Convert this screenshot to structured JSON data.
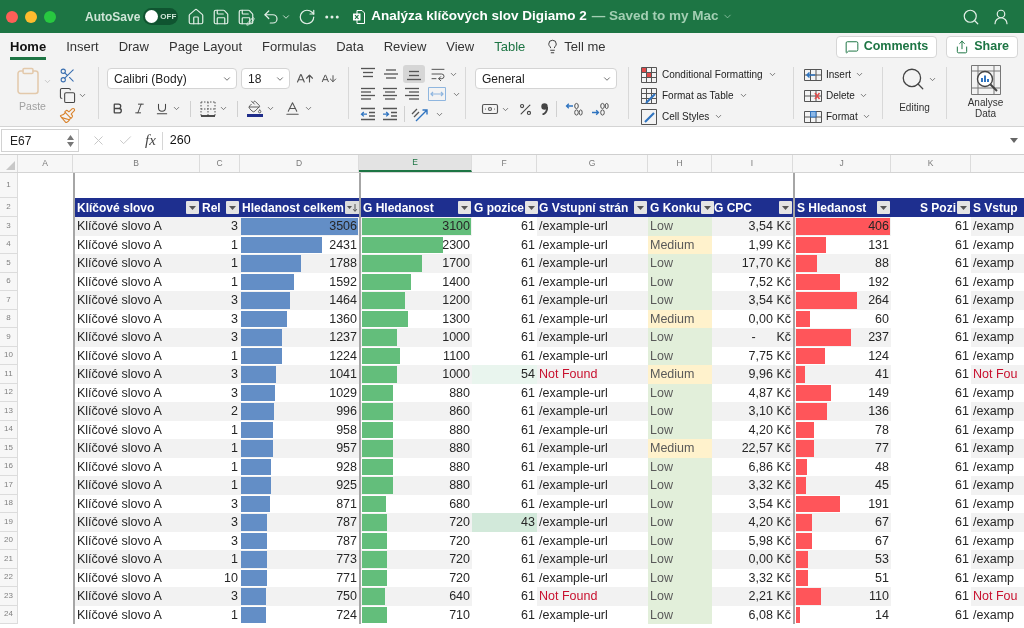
{
  "window": {
    "title": "Analýza klíčových slov Digiamo 2",
    "save_status": "— Saved to my Mac",
    "autosave": {
      "label": "AutoSave",
      "on": false,
      "switch_text": "OFF"
    }
  },
  "ribbon_tabs": [
    {
      "label": "Home",
      "selected": true,
      "kind": "standard"
    },
    {
      "label": "Insert",
      "selected": false,
      "kind": "standard"
    },
    {
      "label": "Draw",
      "selected": false,
      "kind": "standard"
    },
    {
      "label": "Page Layout",
      "selected": false,
      "kind": "standard"
    },
    {
      "label": "Formulas",
      "selected": false,
      "kind": "standard"
    },
    {
      "label": "Data",
      "selected": false,
      "kind": "standard"
    },
    {
      "label": "Review",
      "selected": false,
      "kind": "standard"
    },
    {
      "label": "View",
      "selected": false,
      "kind": "standard"
    },
    {
      "label": "Table",
      "selected": false,
      "kind": "contextual"
    }
  ],
  "tell_me": "Tell me",
  "header_buttons": [
    {
      "label": "Comments",
      "kind": "comments"
    },
    {
      "label": "Share",
      "kind": "share"
    }
  ],
  "toolbar": {
    "paste": {
      "label": "Paste",
      "disabled": true
    },
    "font_name": "Calibri (Body)",
    "font_size": "18",
    "vertical_align": [
      {
        "kind": "top",
        "selected": false
      },
      {
        "kind": "middle",
        "selected": false
      },
      {
        "kind": "bottom",
        "selected": true
      }
    ],
    "number_format": "General",
    "styles": [
      {
        "label": "Conditional Formatting",
        "kind": "conditional"
      },
      {
        "label": "Format as Table",
        "kind": "table"
      },
      {
        "label": "Cell Styles",
        "kind": "cell_styles"
      }
    ],
    "cells": [
      {
        "label": "Insert",
        "kind": "insert"
      },
      {
        "label": "Delete",
        "kind": "delete"
      },
      {
        "label": "Format",
        "kind": "format"
      }
    ],
    "editing": "Editing",
    "analyse": "Analyse Data"
  },
  "formula_bar": {
    "name_box": "E67",
    "function_label": "fx",
    "value": "260"
  },
  "column_headers": [
    {
      "label": "A",
      "selected": false
    },
    {
      "label": "B",
      "selected": false
    },
    {
      "label": "C",
      "selected": false
    },
    {
      "label": "D",
      "selected": false
    },
    {
      "label": "E",
      "selected": true
    },
    {
      "label": "F",
      "selected": false
    },
    {
      "label": "G",
      "selected": false
    },
    {
      "label": "H",
      "selected": false
    },
    {
      "label": "I",
      "selected": false
    },
    {
      "label": "J",
      "selected": false
    },
    {
      "label": "K",
      "selected": false
    }
  ],
  "row_numbers": [
    "1",
    "2",
    "3",
    "4",
    "5",
    "6",
    "7",
    "8",
    "9",
    "10",
    "11",
    "12",
    "13",
    "14",
    "15",
    "16",
    "17",
    "18",
    "19",
    "20",
    "21",
    "22",
    "23",
    "24"
  ],
  "table": {
    "columns": [
      {
        "label": "Klíčové slovo",
        "kind": "text",
        "filter": true,
        "sorted": false
      },
      {
        "label": "Rel",
        "kind": "number",
        "filter": true,
        "sorted": false
      },
      {
        "label": "Hledanost celkem",
        "kind": "data_bar",
        "color": "#638ec6",
        "filter": true,
        "sorted": true
      },
      {
        "label": "G Hledanost",
        "kind": "data_bar",
        "color": "#63be7b",
        "filter": true,
        "sorted": false
      },
      {
        "label": "G pozice",
        "kind": "scale",
        "filter": true,
        "sorted": false
      },
      {
        "label": "G Vstupní strán",
        "kind": "link",
        "filter": true,
        "sorted": false
      },
      {
        "label": "G Konku",
        "kind": "tag",
        "filter": true,
        "sorted": false
      },
      {
        "label": "G CPC",
        "kind": "number",
        "filter": true,
        "sorted": false
      },
      {
        "label": "S Hledanost",
        "kind": "data_bar",
        "color": "#ff555a",
        "filter": true,
        "sorted": false
      },
      {
        "label": "S Pozi",
        "kind": "scale",
        "filter": true,
        "sorted": false
      },
      {
        "label": "S Vstup",
        "kind": "link"
      }
    ],
    "rows": [
      {
        "cells": [
          "Klíčové slovo A",
          "3",
          {
            "text": "3506",
            "level": 1
          },
          {
            "text": "3100",
            "level": 1
          },
          {
            "text": "61",
            "color": "#ffffff"
          },
          {
            "text": "/example-url",
            "kind": "url"
          },
          {
            "text": "Low",
            "color": "#e2efda"
          },
          "3,54 Kč",
          {
            "text": "406",
            "level": 1
          },
          {
            "text": "61",
            "color": "#ffffff"
          },
          {
            "text": "/examp",
            "kind": "url"
          }
        ]
      },
      {
        "cells": [
          "Klíčové slovo A",
          "1",
          {
            "text": "2431",
            "level": 0.69
          },
          {
            "text": "2300",
            "level": 0.74
          },
          {
            "text": "61",
            "color": "#ffffff"
          },
          {
            "text": "/example-url",
            "kind": "url"
          },
          {
            "text": "Medium",
            "color": "#fff2cc"
          },
          "1,99 Kč",
          {
            "text": "131",
            "level": 0.32
          },
          {
            "text": "61",
            "color": "#ffffff"
          },
          {
            "text": "/examp",
            "kind": "url"
          }
        ]
      },
      {
        "cells": [
          "Klíčové slovo A",
          "1",
          {
            "text": "1788",
            "level": 0.51
          },
          {
            "text": "1700",
            "level": 0.55
          },
          {
            "text": "61",
            "color": "#ffffff"
          },
          {
            "text": "/example-url",
            "kind": "url"
          },
          {
            "text": "Low",
            "color": "#e2efda"
          },
          "17,70 Kč",
          {
            "text": "88",
            "level": 0.22
          },
          {
            "text": "61",
            "color": "#ffffff"
          },
          {
            "text": "/examp",
            "kind": "url"
          }
        ]
      },
      {
        "cells": [
          "Klíčové slovo A",
          "1",
          {
            "text": "1592",
            "level": 0.45
          },
          {
            "text": "1400",
            "level": 0.45
          },
          {
            "text": "61",
            "color": "#ffffff"
          },
          {
            "text": "/example-url",
            "kind": "url"
          },
          {
            "text": "Low",
            "color": "#e2efda"
          },
          "7,52 Kč",
          {
            "text": "192",
            "level": 0.47
          },
          {
            "text": "61",
            "color": "#ffffff"
          },
          {
            "text": "/examp",
            "kind": "url"
          }
        ]
      },
      {
        "cells": [
          "Klíčové slovo A",
          "3",
          {
            "text": "1464",
            "level": 0.42
          },
          {
            "text": "1200",
            "level": 0.39
          },
          {
            "text": "61",
            "color": "#ffffff"
          },
          {
            "text": "/example-url",
            "kind": "url"
          },
          {
            "text": "Low",
            "color": "#e2efda"
          },
          "3,54 Kč",
          {
            "text": "264",
            "level": 0.65
          },
          {
            "text": "61",
            "color": "#ffffff"
          },
          {
            "text": "/examp",
            "kind": "url"
          }
        ]
      },
      {
        "cells": [
          "Klíčové slovo A",
          "3",
          {
            "text": "1360",
            "level": 0.39
          },
          {
            "text": "1300",
            "level": 0.42
          },
          {
            "text": "61",
            "color": "#ffffff"
          },
          {
            "text": "/example-url",
            "kind": "url"
          },
          {
            "text": "Medium",
            "color": "#fff2cc"
          },
          "0,00 Kč",
          {
            "text": "60",
            "level": 0.15
          },
          {
            "text": "61",
            "color": "#ffffff"
          },
          {
            "text": "/examp",
            "kind": "url"
          }
        ]
      },
      {
        "cells": [
          "Klíčové slovo A",
          "3",
          {
            "text": "1237",
            "level": 0.35
          },
          {
            "text": "1000",
            "level": 0.32
          },
          {
            "text": "61",
            "color": "#ffffff"
          },
          {
            "text": "/example-url",
            "kind": "url"
          },
          {
            "text": "Low",
            "color": "#e2efda"
          },
          "-      Kč",
          {
            "text": "237",
            "level": 0.58
          },
          {
            "text": "61",
            "color": "#ffffff"
          },
          {
            "text": "/examp",
            "kind": "url"
          }
        ]
      },
      {
        "cells": [
          "Klíčové slovo A",
          "1",
          {
            "text": "1224",
            "level": 0.35
          },
          {
            "text": "1100",
            "level": 0.35
          },
          {
            "text": "61",
            "color": "#ffffff"
          },
          {
            "text": "/example-url",
            "kind": "url"
          },
          {
            "text": "Low",
            "color": "#e2efda"
          },
          "7,75 Kč",
          {
            "text": "124",
            "level": 0.31
          },
          {
            "text": "61",
            "color": "#ffffff"
          },
          {
            "text": "/examp",
            "kind": "url"
          }
        ]
      },
      {
        "cells": [
          "Klíčové slovo A",
          "3",
          {
            "text": "1041",
            "level": 0.3
          },
          {
            "text": "1000",
            "level": 0.32
          },
          {
            "text": "54",
            "color": "#e9f5ee"
          },
          {
            "text": "Not Found",
            "kind": "not_found"
          },
          {
            "text": "Medium",
            "color": "#fff2cc"
          },
          "9,96 Kč",
          {
            "text": "41",
            "level": 0.1
          },
          {
            "text": "61",
            "color": "#ffffff"
          },
          {
            "text": "Not Fou",
            "kind": "not_found"
          }
        ]
      },
      {
        "cells": [
          "Klíčové slovo A",
          "3",
          {
            "text": "1029",
            "level": 0.29
          },
          {
            "text": "880",
            "level": 0.28
          },
          {
            "text": "61",
            "color": "#ffffff"
          },
          {
            "text": "/example-url",
            "kind": "url"
          },
          {
            "text": "Low",
            "color": "#e2efda"
          },
          "4,87 Kč",
          {
            "text": "149",
            "level": 0.37
          },
          {
            "text": "61",
            "color": "#ffffff"
          },
          {
            "text": "/examp",
            "kind": "url"
          }
        ]
      },
      {
        "cells": [
          "Klíčové slovo A",
          "2",
          {
            "text": "996",
            "level": 0.28
          },
          {
            "text": "860",
            "level": 0.28
          },
          {
            "text": "61",
            "color": "#ffffff"
          },
          {
            "text": "/example-url",
            "kind": "url"
          },
          {
            "text": "Low",
            "color": "#e2efda"
          },
          "3,10 Kč",
          {
            "text": "136",
            "level": 0.33
          },
          {
            "text": "61",
            "color": "#ffffff"
          },
          {
            "text": "/examp",
            "kind": "url"
          }
        ]
      },
      {
        "cells": [
          "Klíčové slovo A",
          "1",
          {
            "text": "958",
            "level": 0.27
          },
          {
            "text": "880",
            "level": 0.28
          },
          {
            "text": "61",
            "color": "#ffffff"
          },
          {
            "text": "/example-url",
            "kind": "url"
          },
          {
            "text": "Low",
            "color": "#e2efda"
          },
          "4,20 Kč",
          {
            "text": "78",
            "level": 0.19
          },
          {
            "text": "61",
            "color": "#ffffff"
          },
          {
            "text": "/examp",
            "kind": "url"
          }
        ]
      },
      {
        "cells": [
          "Klíčové slovo A",
          "1",
          {
            "text": "957",
            "level": 0.27
          },
          {
            "text": "880",
            "level": 0.28
          },
          {
            "text": "61",
            "color": "#ffffff"
          },
          {
            "text": "/example-url",
            "kind": "url"
          },
          {
            "text": "Medium",
            "color": "#fff2cc"
          },
          "22,57 Kč",
          {
            "text": "77",
            "level": 0.19
          },
          {
            "text": "61",
            "color": "#ffffff"
          },
          {
            "text": "/examp",
            "kind": "url"
          }
        ]
      },
      {
        "cells": [
          "Klíčové slovo A",
          "1",
          {
            "text": "928",
            "level": 0.26
          },
          {
            "text": "880",
            "level": 0.28
          },
          {
            "text": "61",
            "color": "#ffffff"
          },
          {
            "text": "/example-url",
            "kind": "url"
          },
          {
            "text": "Low",
            "color": "#e2efda"
          },
          "6,86 Kč",
          {
            "text": "48",
            "level": 0.12
          },
          {
            "text": "61",
            "color": "#ffffff"
          },
          {
            "text": "/examp",
            "kind": "url"
          }
        ]
      },
      {
        "cells": [
          "Klíčové slovo A",
          "1",
          {
            "text": "925",
            "level": 0.26
          },
          {
            "text": "880",
            "level": 0.28
          },
          {
            "text": "61",
            "color": "#ffffff"
          },
          {
            "text": "/example-url",
            "kind": "url"
          },
          {
            "text": "Low",
            "color": "#e2efda"
          },
          "3,32 Kč",
          {
            "text": "45",
            "level": 0.11
          },
          {
            "text": "61",
            "color": "#ffffff"
          },
          {
            "text": "/examp",
            "kind": "url"
          }
        ]
      },
      {
        "cells": [
          "Klíčové slovo A",
          "3",
          {
            "text": "871",
            "level": 0.25
          },
          {
            "text": "680",
            "level": 0.22
          },
          {
            "text": "61",
            "color": "#ffffff"
          },
          {
            "text": "/example-url",
            "kind": "url"
          },
          {
            "text": "Low",
            "color": "#e2efda"
          },
          "3,54 Kč",
          {
            "text": "191",
            "level": 0.47
          },
          {
            "text": "61",
            "color": "#ffffff"
          },
          {
            "text": "/examp",
            "kind": "url"
          }
        ]
      },
      {
        "cells": [
          "Klíčové slovo A",
          "3",
          {
            "text": "787",
            "level": 0.22
          },
          {
            "text": "720",
            "level": 0.23
          },
          {
            "text": "43",
            "color": "#d2e9da"
          },
          {
            "text": "/example-url",
            "kind": "url"
          },
          {
            "text": "Low",
            "color": "#e2efda"
          },
          "4,20 Kč",
          {
            "text": "67",
            "level": 0.17
          },
          {
            "text": "61",
            "color": "#ffffff"
          },
          {
            "text": "/examp",
            "kind": "url"
          }
        ]
      },
      {
        "cells": [
          "Klíčové slovo A",
          "3",
          {
            "text": "787",
            "level": 0.22
          },
          {
            "text": "720",
            "level": 0.23
          },
          {
            "text": "61",
            "color": "#ffffff"
          },
          {
            "text": "/example-url",
            "kind": "url"
          },
          {
            "text": "Low",
            "color": "#e2efda"
          },
          "5,98 Kč",
          {
            "text": "67",
            "level": 0.17
          },
          {
            "text": "61",
            "color": "#ffffff"
          },
          {
            "text": "/examp",
            "kind": "url"
          }
        ]
      },
      {
        "cells": [
          "Klíčové slovo A",
          "1",
          {
            "text": "773",
            "level": 0.22
          },
          {
            "text": "720",
            "level": 0.23
          },
          {
            "text": "61",
            "color": "#ffffff"
          },
          {
            "text": "/example-url",
            "kind": "url"
          },
          {
            "text": "Low",
            "color": "#e2efda"
          },
          "0,00 Kč",
          {
            "text": "53",
            "level": 0.13
          },
          {
            "text": "61",
            "color": "#ffffff"
          },
          {
            "text": "/examp",
            "kind": "url"
          }
        ]
      },
      {
        "cells": [
          "Klíčové slovo A",
          "10",
          {
            "text": "771",
            "level": 0.22
          },
          {
            "text": "720",
            "level": 0.23
          },
          {
            "text": "61",
            "color": "#ffffff"
          },
          {
            "text": "/example-url",
            "kind": "url"
          },
          {
            "text": "Low",
            "color": "#e2efda"
          },
          "3,32 Kč",
          {
            "text": "51",
            "level": 0.13
          },
          {
            "text": "61",
            "color": "#ffffff"
          },
          {
            "text": "/examp",
            "kind": "url"
          }
        ]
      },
      {
        "cells": [
          "Klíčové slovo A",
          "3",
          {
            "text": "750",
            "level": 0.21
          },
          {
            "text": "640",
            "level": 0.21
          },
          {
            "text": "61",
            "color": "#ffffff"
          },
          {
            "text": "Not Found",
            "kind": "not_found"
          },
          {
            "text": "Low",
            "color": "#e2efda"
          },
          "2,21 Kč",
          {
            "text": "110",
            "level": 0.27
          },
          {
            "text": "61",
            "color": "#ffffff"
          },
          {
            "text": "Not Fou",
            "kind": "not_found"
          }
        ]
      },
      {
        "cells": [
          "Klíčové slovo A",
          "1",
          {
            "text": "724",
            "level": 0.21
          },
          {
            "text": "710",
            "level": 0.23
          },
          {
            "text": "61",
            "color": "#ffffff"
          },
          {
            "text": "/example-url",
            "kind": "url"
          },
          {
            "text": "Low",
            "color": "#e2efda"
          },
          "6,08 Kč",
          {
            "text": "14",
            "level": 0.04
          },
          {
            "text": "61",
            "color": "#ffffff"
          },
          {
            "text": "/examp",
            "kind": "url"
          }
        ]
      }
    ]
  }
}
